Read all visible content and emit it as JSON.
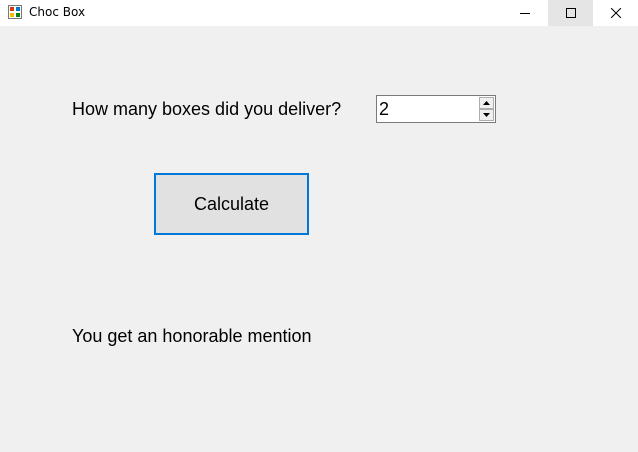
{
  "window": {
    "title": "Choc Box",
    "icon": "winforms-app-icon",
    "controls": {
      "minimize_icon": "minimize-icon",
      "maximize_icon": "maximize-icon",
      "close_icon": "close-icon"
    }
  },
  "form": {
    "question_label": "How many boxes did you deliver?",
    "boxes_value": "2",
    "calculate_label": "Calculate",
    "result_text": "You get an honorable mention"
  },
  "colors": {
    "window_bg": "#f0f0f0",
    "titlebar_bg": "#ffffff",
    "button_focus_border": "#0078d7"
  }
}
